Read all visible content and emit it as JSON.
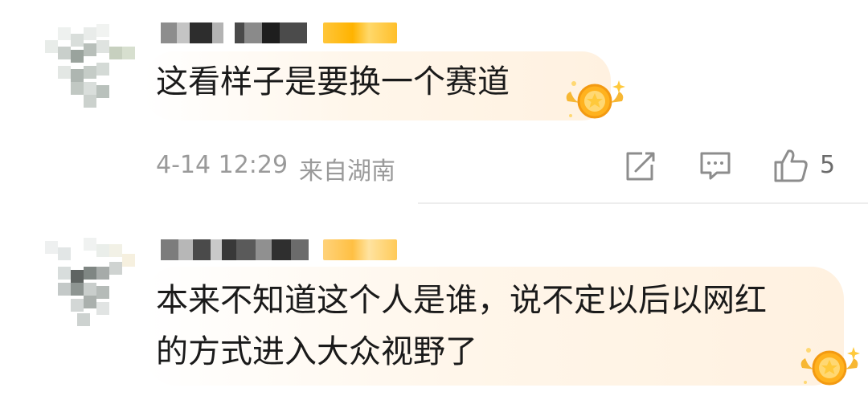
{
  "comments": [
    {
      "text": "这看样子是要换一个赛道",
      "time": "4-14 12:29",
      "location": "来自湖南",
      "likes": "5"
    },
    {
      "line1": "本来不知道这个人是谁，说不定以后以网红",
      "line2": "的方式进入大众视野了"
    }
  ],
  "icons": {
    "repost": "share-edit-icon",
    "comment": "comment-bubble-icon",
    "like": "thumbs-up-icon",
    "badge": "star-medal-icon"
  },
  "colors": {
    "text": "#1a1a1a",
    "meta": "#9a9a9a",
    "vip": "#ffb91a",
    "bubble": "#fff1e0"
  }
}
